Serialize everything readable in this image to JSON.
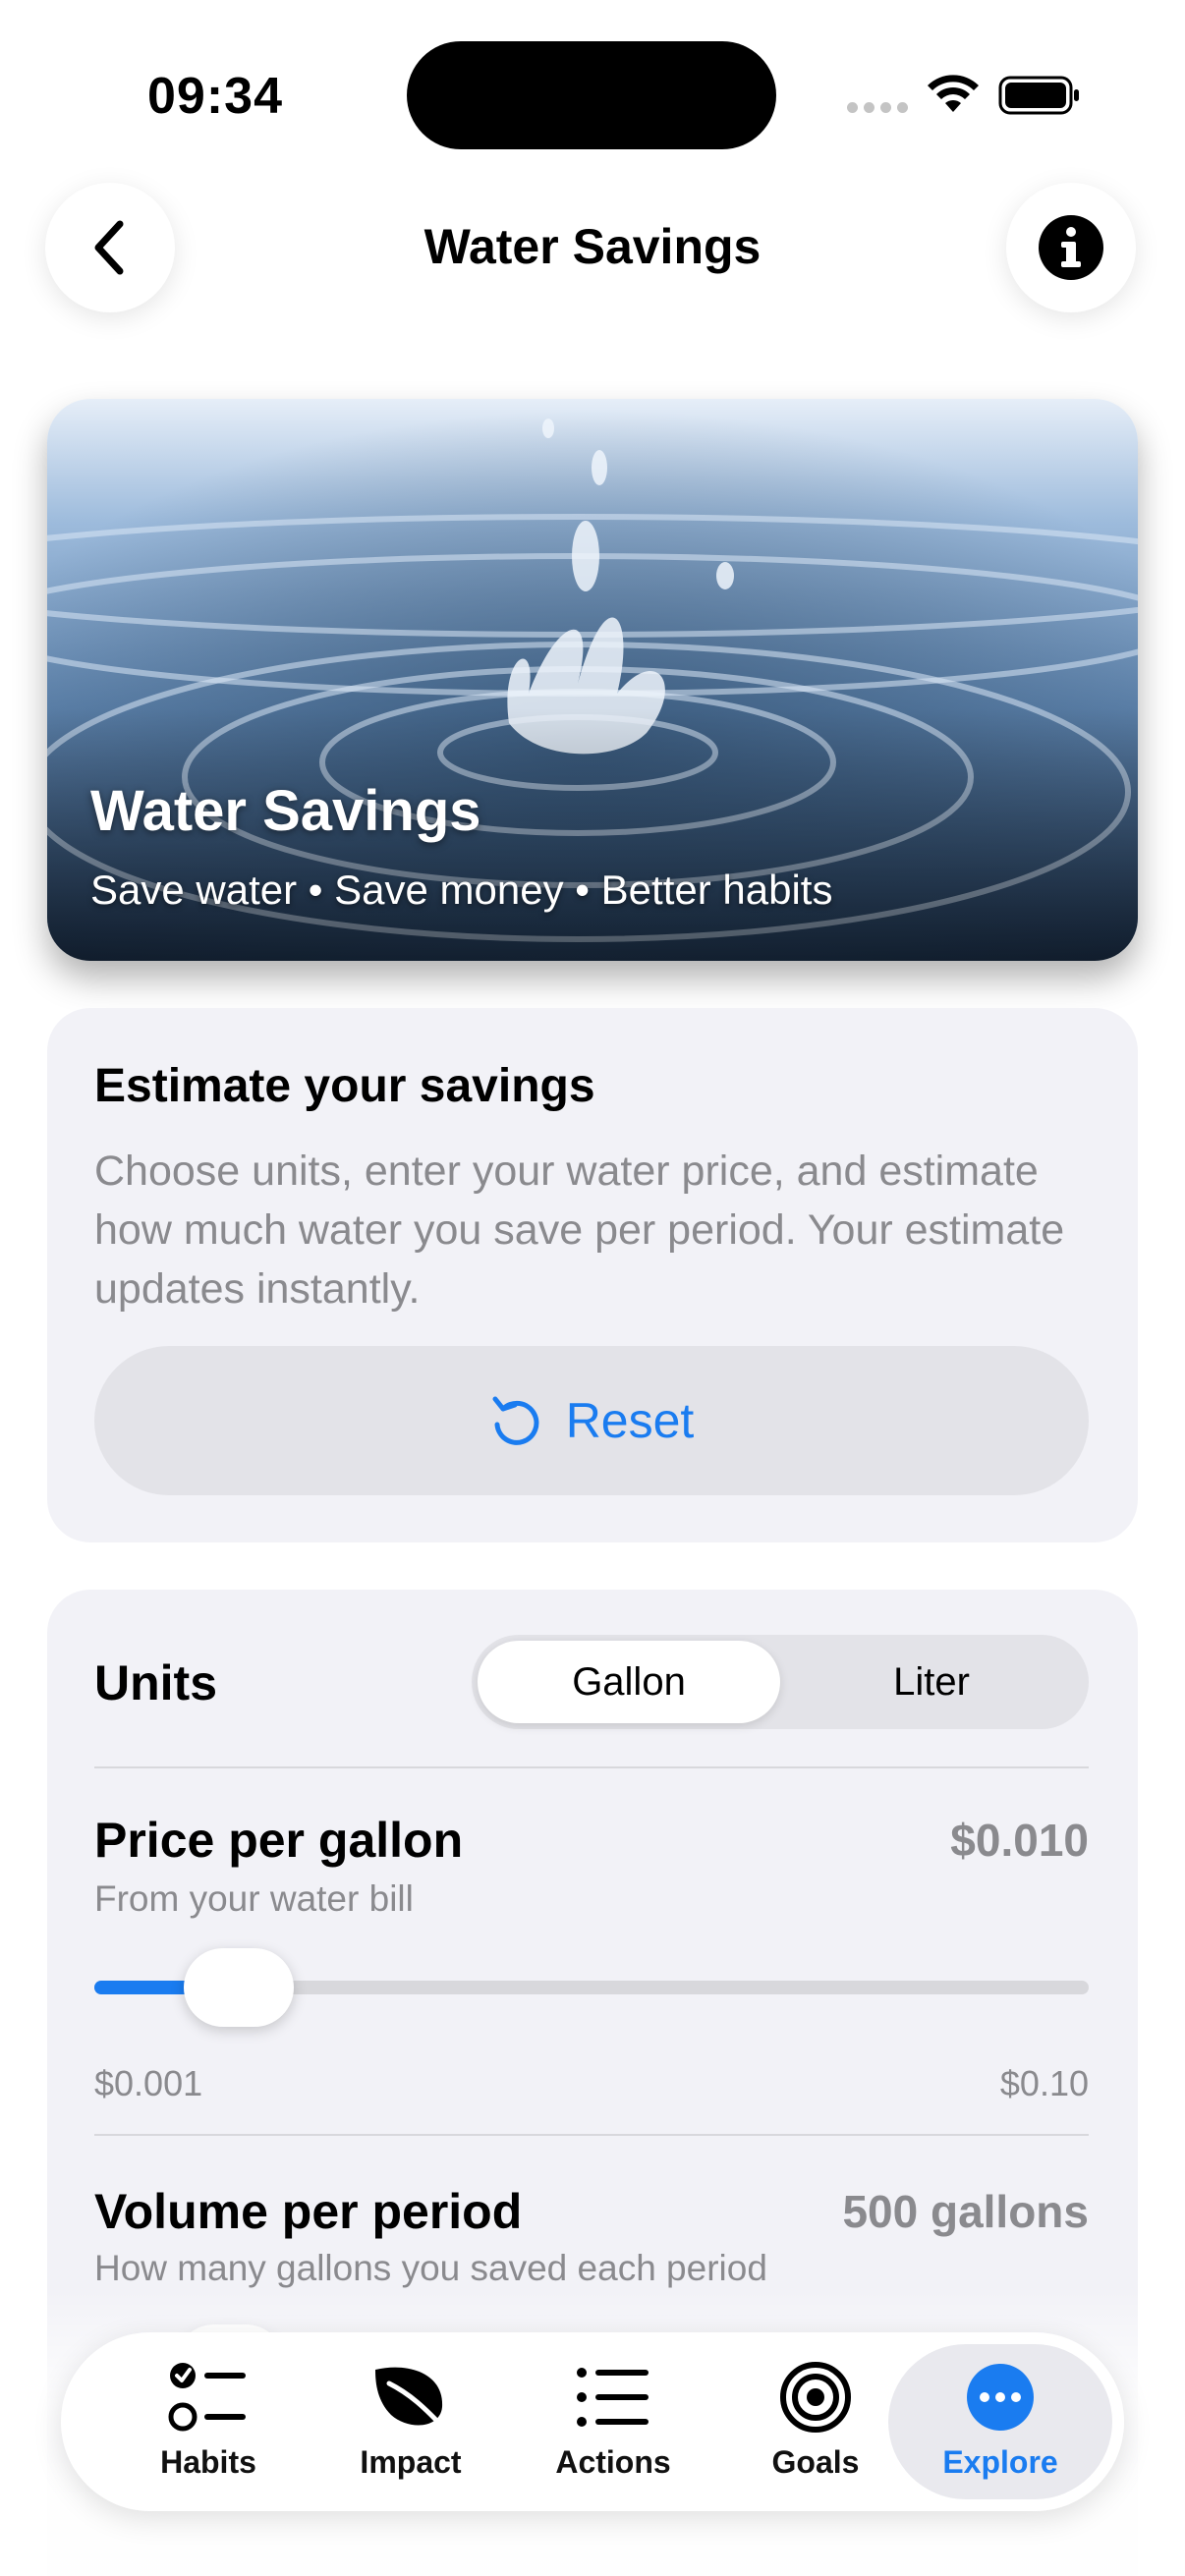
{
  "status_bar": {
    "time": "09:34"
  },
  "nav": {
    "title": "Water Savings",
    "back_icon": "chevron-left-icon",
    "info_icon": "info-icon"
  },
  "hero": {
    "title": "Water Savings",
    "subtitle": "Save water • Save money • Better habits",
    "image": "water-splash-photo"
  },
  "estimate": {
    "heading": "Estimate your savings",
    "description": "Choose units, enter your water price, and estimate how much water you save per period. Your estimate updates instantly.",
    "reset_label": "Reset"
  },
  "settings": {
    "units_label": "Units",
    "units_options": [
      "Gallon",
      "Liter"
    ],
    "units_selected": "Gallon",
    "price": {
      "label": "Price per gallon",
      "value": "$0.010",
      "subtitle": "From your water bill",
      "min_label": "$0.001",
      "max_label": "$0.10",
      "slider_fraction": 0.09
    },
    "volume": {
      "label": "Volume per period",
      "value": "500 gallons",
      "subtitle": "How many gallons you saved each period"
    }
  },
  "tabs": [
    {
      "label": "Habits",
      "icon": "checklist-icon"
    },
    {
      "label": "Impact",
      "icon": "leaf-icon"
    },
    {
      "label": "Actions",
      "icon": "list-icon"
    },
    {
      "label": "Goals",
      "icon": "target-icon"
    },
    {
      "label": "Explore",
      "icon": "more-icon",
      "active": true
    }
  ],
  "colors": {
    "accent": "#1a7cf0",
    "card": "#f2f2f7",
    "secondary_text": "#8a8a8e"
  }
}
